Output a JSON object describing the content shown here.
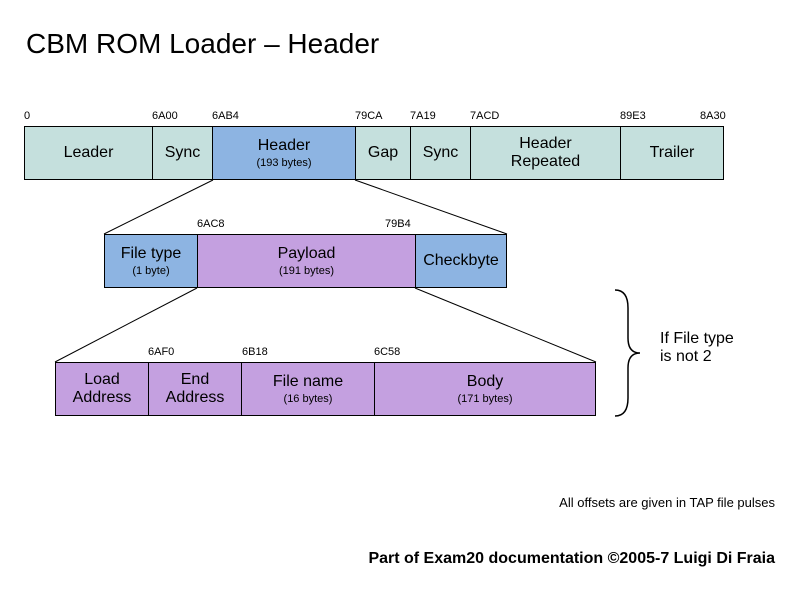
{
  "title": "CBM ROM Loader – Header",
  "row1": {
    "offsets": [
      "0",
      "6A00",
      "6AB4",
      "79CA",
      "7A19",
      "7ACD",
      "89E3",
      "8A30"
    ],
    "cells": [
      {
        "label": "Leader",
        "sub": ""
      },
      {
        "label": "Sync",
        "sub": ""
      },
      {
        "label": "Header",
        "sub": "(193 bytes)"
      },
      {
        "label": "Gap",
        "sub": ""
      },
      {
        "label": "Sync",
        "sub": ""
      },
      {
        "label": "Header Repeated",
        "sub": ""
      },
      {
        "label": "Trailer",
        "sub": ""
      }
    ]
  },
  "row2": {
    "offsets": [
      "6AC8",
      "79B4"
    ],
    "cells": [
      {
        "label": "File type",
        "sub": "(1 byte)"
      },
      {
        "label": "Payload",
        "sub": "(191 bytes)"
      },
      {
        "label": "Checkbyte",
        "sub": ""
      }
    ]
  },
  "row3": {
    "offsets": [
      "6AF0",
      "6B18",
      "6C58"
    ],
    "cells": [
      {
        "label": "Load Address",
        "sub": ""
      },
      {
        "label": "End Address",
        "sub": ""
      },
      {
        "label": "File name",
        "sub": "(16 bytes)"
      },
      {
        "label": "Body",
        "sub": "(171 bytes)"
      }
    ]
  },
  "annotation": "If File type\nis not 2",
  "note": "All offsets are given in TAP file pulses",
  "footer": "Part of Exam20 documentation ©2005-7 Luigi Di Fraia"
}
